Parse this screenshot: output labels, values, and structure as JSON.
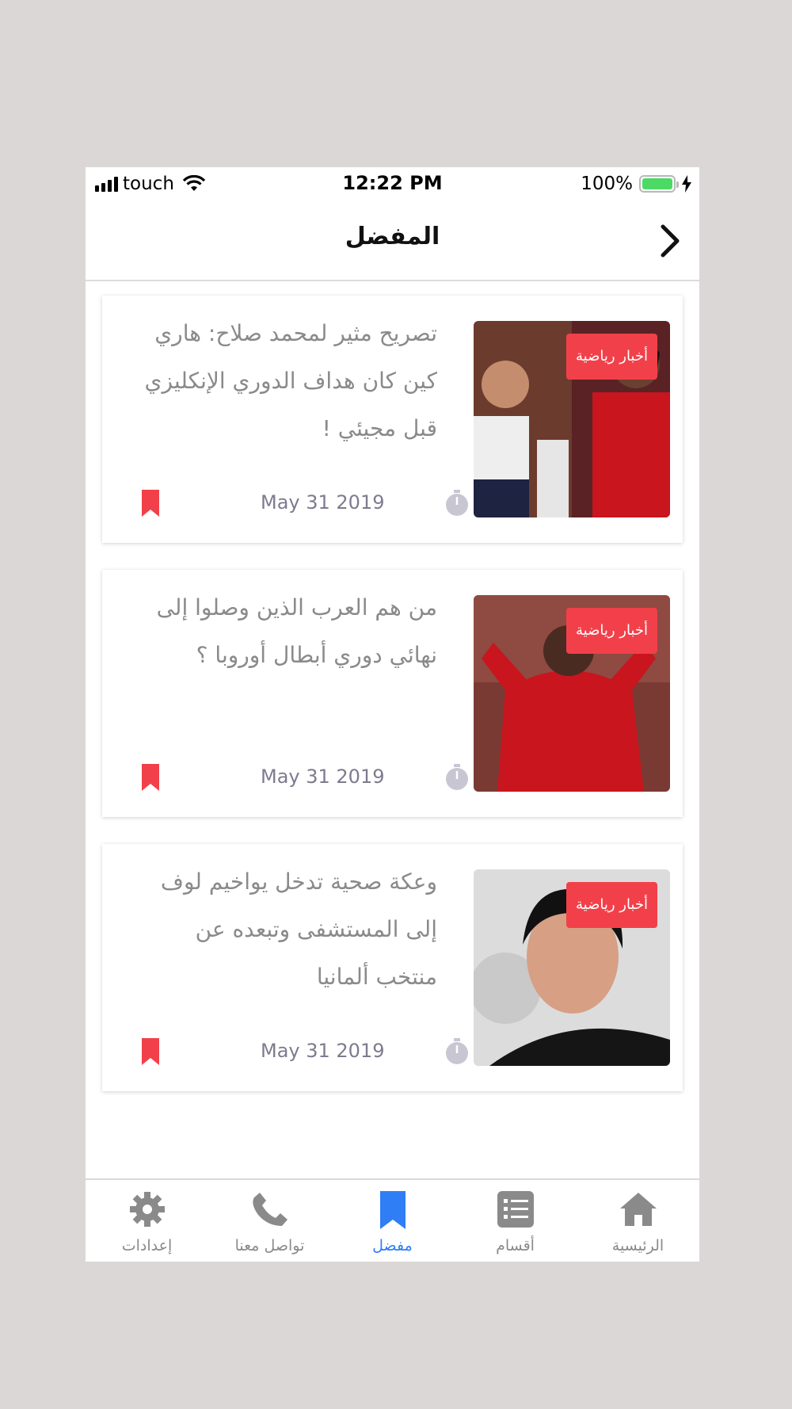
{
  "status_bar": {
    "carrier": "touch",
    "time": "12:22 PM",
    "battery": "100%",
    "battery_level": 1.0
  },
  "nav": {
    "title": "المفضل",
    "back_icon": "chevron-right-icon"
  },
  "articles": [
    {
      "category": "أخبار رياضية",
      "title": "تصريح مثير لمحمد صلاح: هاري كين كان هداف الدوري الإنكليزي قبل مجيئي !",
      "date": "May 31 2019"
    },
    {
      "category": "أخبار رياضية",
      "title": "من هم العرب الذين وصلوا إلى نهائي دوري أبطال أوروبا ؟",
      "date": "May 31 2019"
    },
    {
      "category": "أخبار رياضية",
      "title": "وعكة صحية تدخل يواخيم لوف إلى المستشفى وتبعده عن منتخب ألمانيا",
      "date": "May 31 2019"
    }
  ],
  "tabs": [
    {
      "label": "الرئيسية",
      "icon": "home-icon"
    },
    {
      "label": "أقسام",
      "icon": "list-icon"
    },
    {
      "label": "مفضل",
      "icon": "bookmark-icon",
      "active": true
    },
    {
      "label": "تواصل معنا",
      "icon": "phone-icon"
    },
    {
      "label": "إعدادات",
      "icon": "gear-icon"
    }
  ],
  "colors": {
    "accent": "#f2404a",
    "active_tab": "#2f7ef5",
    "inactive_tab": "#8a8a8a",
    "battery": "#4cd964"
  }
}
